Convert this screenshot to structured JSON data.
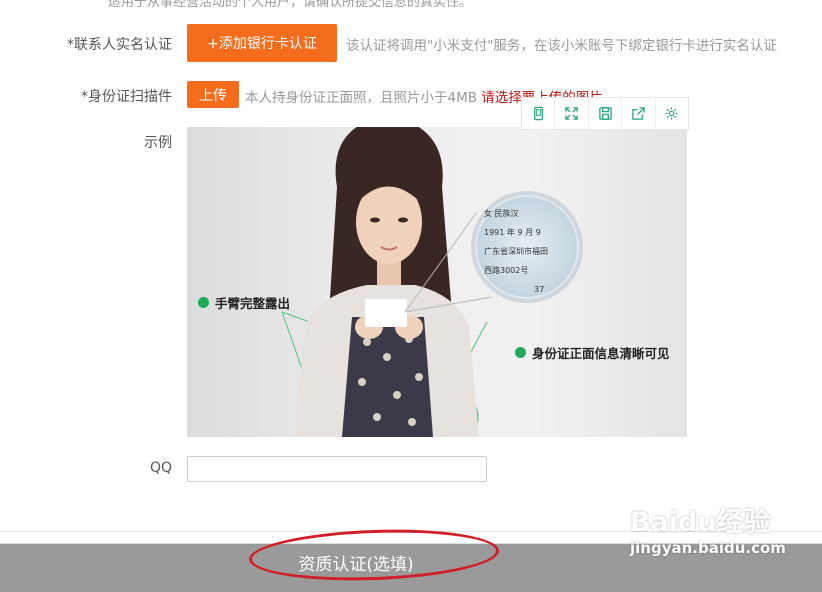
{
  "top_cut_text": "适用于从事经营活动的个人用户，请确认所提交信息的真实性。",
  "realname": {
    "label": "*联系人实名认证",
    "button": "+添加银行卡认证",
    "hint": "该认证将调用\"小米支付\"服务，在该小米账号下绑定银行卡进行实名认证"
  },
  "idcard": {
    "label": "*身份证扫描件",
    "upload_button": "上传",
    "hint": "本人持身份证正面照，且照片小于4MB",
    "error": "请选择要上传的图片。"
  },
  "example": {
    "label": "示例",
    "callout_left": "手臂完整露出",
    "callout_right": "身份证正面信息清晰可见",
    "card": {
      "line1": "女  民族汉",
      "line2": "1991 年 9 月 9",
      "line3": "广东省深圳市福田",
      "line4": "西路3002号",
      "line5": "37"
    }
  },
  "toolbar": {
    "icons": [
      "phone-icon",
      "fullscreen-icon",
      "save-icon",
      "share-icon",
      "settings-icon"
    ]
  },
  "qq": {
    "label": "QQ",
    "value": "",
    "placeholder": ""
  },
  "bottom": {
    "title": "资质认证(选填)"
  },
  "watermark": {
    "brand": "Baidu经验",
    "url": "jingyan.baidu.com"
  },
  "colors": {
    "accent": "#f56c1d",
    "error": "#b71a14",
    "green": "#1eaa5a",
    "mark": "#d01f26"
  }
}
